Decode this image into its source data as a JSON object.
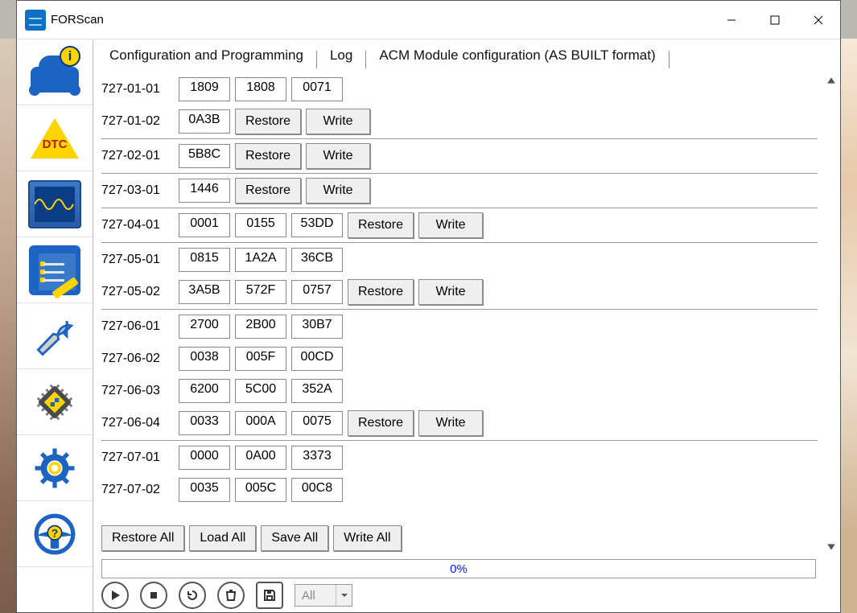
{
  "title": "FORScan",
  "tabs": {
    "config": "Configuration and Programming",
    "log": "Log",
    "active": "ACM Module configuration (AS BUILT format)"
  },
  "labels": {
    "restore": "Restore",
    "write": "Write",
    "restore_all": "Restore All",
    "load_all": "Load All",
    "save_all": "Save All",
    "write_all": "Write All"
  },
  "progress": "0%",
  "filter": "All",
  "groups": [
    {
      "rows": [
        {
          "addr": "727-01-01",
          "v": [
            "1809",
            "1808",
            "0071"
          ]
        },
        {
          "addr": "727-01-02",
          "v": [
            "0A3B"
          ],
          "rw": true
        }
      ]
    },
    {
      "rows": [
        {
          "addr": "727-02-01",
          "v": [
            "5B8C"
          ],
          "rw": true
        }
      ]
    },
    {
      "rows": [
        {
          "addr": "727-03-01",
          "v": [
            "1446"
          ],
          "rw": true
        }
      ]
    },
    {
      "rows": [
        {
          "addr": "727-04-01",
          "v": [
            "0001",
            "0155",
            "53DD"
          ],
          "rw": true
        }
      ]
    },
    {
      "rows": [
        {
          "addr": "727-05-01",
          "v": [
            "0815",
            "1A2A",
            "36CB"
          ]
        },
        {
          "addr": "727-05-02",
          "v": [
            "3A5B",
            "572F",
            "0757"
          ],
          "rw": true
        }
      ]
    },
    {
      "rows": [
        {
          "addr": "727-06-01",
          "v": [
            "2700",
            "2B00",
            "30B7"
          ]
        },
        {
          "addr": "727-06-02",
          "v": [
            "0038",
            "005F",
            "00CD"
          ]
        },
        {
          "addr": "727-06-03",
          "v": [
            "6200",
            "5C00",
            "352A"
          ]
        },
        {
          "addr": "727-06-04",
          "v": [
            "0033",
            "000A",
            "0075"
          ],
          "rw": true
        }
      ]
    },
    {
      "rows": [
        {
          "addr": "727-07-01",
          "v": [
            "0000",
            "0A00",
            "3373"
          ]
        },
        {
          "addr": "727-07-02",
          "v": [
            "0035",
            "005C",
            "00C8"
          ]
        }
      ]
    }
  ]
}
